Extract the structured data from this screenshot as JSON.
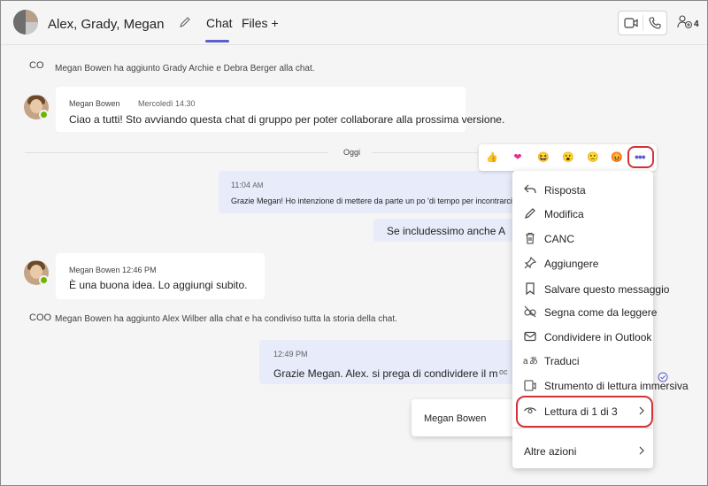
{
  "header": {
    "title": "Alex, Grady, Megan",
    "tab_chat": "Chat",
    "tab_files": "Files +",
    "participants_count": "4"
  },
  "system1": {
    "icon_text": "CO",
    "text": "Megan Bowen ha aggiunto Grady Archie e Debra Berger alla chat."
  },
  "message1": {
    "sender": "Megan Bowen",
    "time": "Mercoledì 14.30",
    "text": "Ciao a tutti! Sto avviando questa chat di gruppo per poter collaborare alla prossima versione."
  },
  "divider": {
    "label": "Oggi"
  },
  "message2": {
    "time": "11:04",
    "time_suffix": "AM",
    "text": "Grazie Megan! Ho intenzione di mettere da parte un po 'di tempo per incontrarci"
  },
  "message3": {
    "text": "Se includessimo anche A"
  },
  "message4": {
    "sender": "Megan Bowen 12:46 PM",
    "text": "È una buona idea. Lo aggiungi subito."
  },
  "system2": {
    "icon_text": "COO",
    "text": "Megan Bowen ha aggiunto Alex Wilber alla chat e ha condiviso tutta la storia della chat."
  },
  "message5": {
    "time": "12:49 PM",
    "text": "Grazie Megan. Alex. si prega di condividere il m",
    "trail": "oc"
  },
  "reactions": [
    "👍",
    "❤",
    "😆",
    "😮",
    "🙁",
    "😡"
  ],
  "menu": {
    "items": [
      {
        "label": "Risposta",
        "icon": "reply-icon"
      },
      {
        "label": "Modifica",
        "icon": "edit-icon"
      },
      {
        "label": "CANC",
        "icon": "delete-icon"
      },
      {
        "label": "Aggiungere",
        "icon": "pin-icon"
      },
      {
        "label": "Salvare questo messaggio",
        "icon": "bookmark-icon"
      },
      {
        "label": "Segna come da leggere",
        "icon": "unread-icon"
      },
      {
        "label": "Condividere in Outlook",
        "icon": "mail-icon"
      },
      {
        "label": "Traduci",
        "icon": "translate-icon"
      },
      {
        "label": "Strumento di lettura immersiva",
        "icon": "immersive-reader-icon"
      },
      {
        "label": "Lettura di 1 di 3",
        "icon": "eye-icon"
      }
    ],
    "more_actions": "Altre azioni"
  },
  "tooltip": {
    "name": "Megan Bowen"
  },
  "colors": {
    "accent": "#5b5fc7",
    "highlight": "#d13438",
    "my_bubble": "#e8ebfa",
    "presence": "#6bb700"
  }
}
